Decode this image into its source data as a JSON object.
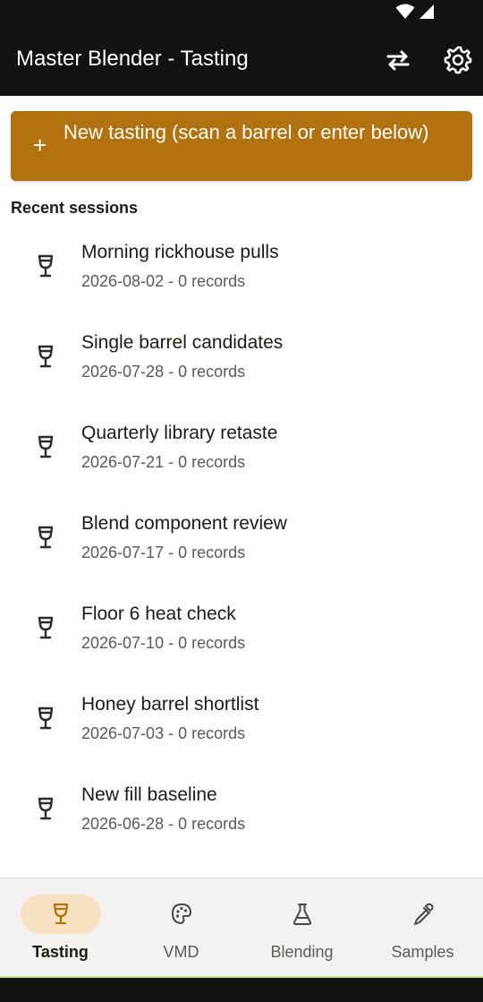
{
  "header": {
    "title": "Master Blender - Tasting",
    "swap_icon": "swap-horizontal-icon",
    "settings_icon": "gear-icon"
  },
  "new_tasting": {
    "icon": "plus-icon",
    "plus": "+",
    "label": "New tasting (scan a barrel or enter below)"
  },
  "section": {
    "title": "Recent sessions"
  },
  "sessions": [
    {
      "title": "Morning rickhouse pulls",
      "subtitle": "2026-08-02 - 0 records"
    },
    {
      "title": "Single barrel candidates",
      "subtitle": "2026-07-28 - 0 records"
    },
    {
      "title": "Quarterly library retaste",
      "subtitle": "2026-07-21 - 0 records"
    },
    {
      "title": "Blend component review",
      "subtitle": "2026-07-17 - 0 records"
    },
    {
      "title": "Floor 6 heat check",
      "subtitle": "2026-07-10 - 0 records"
    },
    {
      "title": "Honey barrel shortlist",
      "subtitle": "2026-07-03 - 0 records"
    },
    {
      "title": "New fill baseline",
      "subtitle": "2026-06-28 - 0 records"
    },
    {
      "title": "",
      "subtitle": ""
    }
  ],
  "bottom_nav": [
    {
      "label": "Tasting",
      "icon": "wine-glass-icon",
      "active": true
    },
    {
      "label": "VMD",
      "icon": "palette-icon",
      "active": false
    },
    {
      "label": "Blending",
      "icon": "flask-icon",
      "active": false
    },
    {
      "label": "Samples",
      "icon": "eyedropper-icon",
      "active": false
    }
  ],
  "colors": {
    "accent": "#b1720f",
    "nav_active_pill": "#f9e2c2",
    "app_bar": "#121212"
  }
}
